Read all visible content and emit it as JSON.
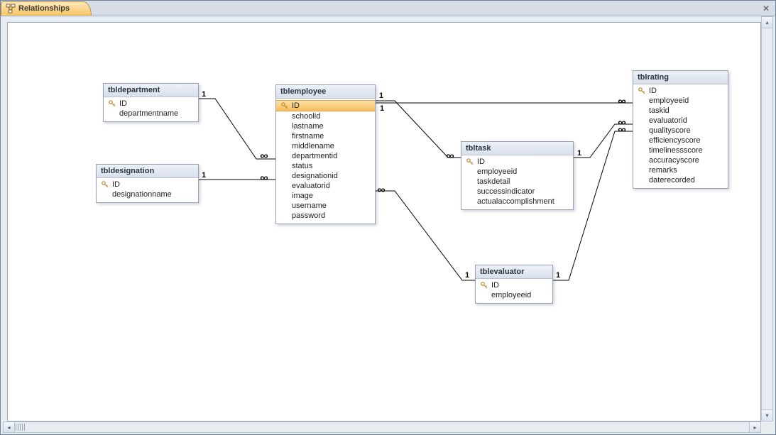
{
  "tab": {
    "title": "Relationships"
  },
  "symbols": {
    "one": "1",
    "many": "∞"
  },
  "entities": {
    "tbldepartment": {
      "title": "tbldepartment",
      "fields": [
        {
          "name": "ID",
          "pk": true
        },
        {
          "name": "departmentname",
          "pk": false
        }
      ]
    },
    "tbldesignation": {
      "title": "tbldesignation",
      "fields": [
        {
          "name": "ID",
          "pk": true
        },
        {
          "name": "designationname",
          "pk": false
        }
      ]
    },
    "tblemployee": {
      "title": "tblemployee",
      "fields": [
        {
          "name": "ID",
          "pk": true,
          "selected": true
        },
        {
          "name": "schoolid",
          "pk": false
        },
        {
          "name": "lastname",
          "pk": false
        },
        {
          "name": "firstname",
          "pk": false
        },
        {
          "name": "middlename",
          "pk": false
        },
        {
          "name": "departmentid",
          "pk": false
        },
        {
          "name": "status",
          "pk": false
        },
        {
          "name": "designationid",
          "pk": false
        },
        {
          "name": "evaluatorid",
          "pk": false
        },
        {
          "name": "image",
          "pk": false
        },
        {
          "name": "username",
          "pk": false
        },
        {
          "name": "password",
          "pk": false
        }
      ]
    },
    "tbltask": {
      "title": "tbltask",
      "fields": [
        {
          "name": "ID",
          "pk": true
        },
        {
          "name": "employeeid",
          "pk": false
        },
        {
          "name": "taskdetail",
          "pk": false
        },
        {
          "name": "successindicator",
          "pk": false
        },
        {
          "name": "actualaccomplishment",
          "pk": false
        }
      ]
    },
    "tblevaluator": {
      "title": "tblevaluator",
      "fields": [
        {
          "name": "ID",
          "pk": true
        },
        {
          "name": "employeeid",
          "pk": false
        }
      ]
    },
    "tblrating": {
      "title": "tblrating",
      "fields": [
        {
          "name": "ID",
          "pk": true
        },
        {
          "name": "employeeid",
          "pk": false
        },
        {
          "name": "taskid",
          "pk": false
        },
        {
          "name": "evaluatorid",
          "pk": false
        },
        {
          "name": "qualityscore",
          "pk": false
        },
        {
          "name": "efficiencyscore",
          "pk": false
        },
        {
          "name": "timelinessscore",
          "pk": false
        },
        {
          "name": "accuracyscore",
          "pk": false
        },
        {
          "name": "remarks",
          "pk": false
        },
        {
          "name": "daterecorded",
          "pk": false
        }
      ]
    }
  },
  "relationships": [
    {
      "from": "tbldepartment",
      "to": "tblemployee",
      "from_card": "one",
      "to_card": "many"
    },
    {
      "from": "tbldesignation",
      "to": "tblemployee",
      "from_card": "one",
      "to_card": "many"
    },
    {
      "from": "tblemployee",
      "to": "tbltask",
      "from_card": "one",
      "to_card": "many"
    },
    {
      "from": "tblemployee",
      "to": "tblrating",
      "from_card": "one",
      "to_card": "many"
    },
    {
      "from": "tblemployee",
      "to": "tblevaluator",
      "from_card": "one",
      "to_card": "many"
    },
    {
      "from": "tbltask",
      "to": "tblrating",
      "from_card": "one",
      "to_card": "many"
    },
    {
      "from": "tblevaluator",
      "to": "tblrating",
      "from_card": "one",
      "to_card": "many"
    }
  ]
}
